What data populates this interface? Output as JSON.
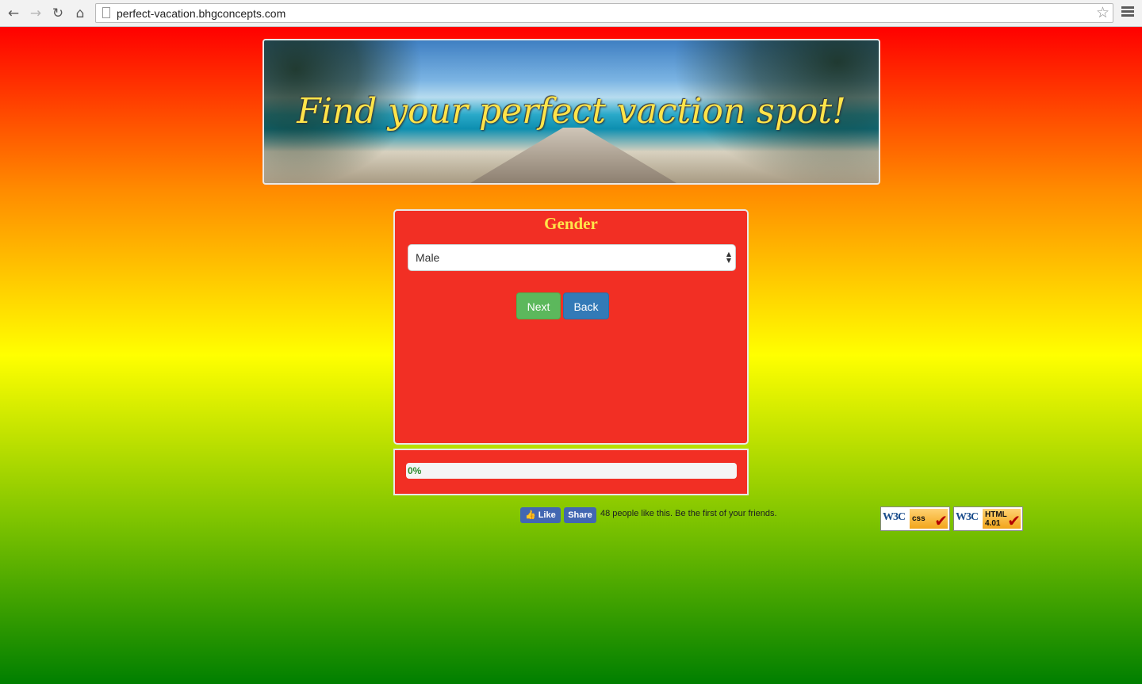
{
  "browser": {
    "url": "perfect-vacation.bhgconcepts.com",
    "back_icon": "arrow-left-icon",
    "forward_icon": "arrow-right-icon",
    "reload_icon": "reload-icon",
    "home_icon": "home-icon",
    "bookmark_icon": "star-icon",
    "menu_icon": "hamburger-menu-icon"
  },
  "banner": {
    "title": "Find your perfect vaction spot!"
  },
  "quiz": {
    "question": "Gender",
    "selected_option": "Male",
    "next_label": "Next",
    "back_label": "Back"
  },
  "progress": {
    "label": "0%",
    "value": 0
  },
  "facebook": {
    "like_label": "Like",
    "share_label": "Share",
    "social_text": "48 people like this. Be the first of your friends."
  },
  "badges": {
    "css": {
      "logo": "W3C",
      "tag": "css"
    },
    "html": {
      "logo": "W3C",
      "tag_line1": "HTML",
      "tag_line2": "4.01"
    }
  },
  "colors": {
    "panel": "#f22f24",
    "question": "#ffe44a",
    "next_button": "#5cb85c",
    "back_button": "#337ab7",
    "facebook": "#4267b2"
  }
}
